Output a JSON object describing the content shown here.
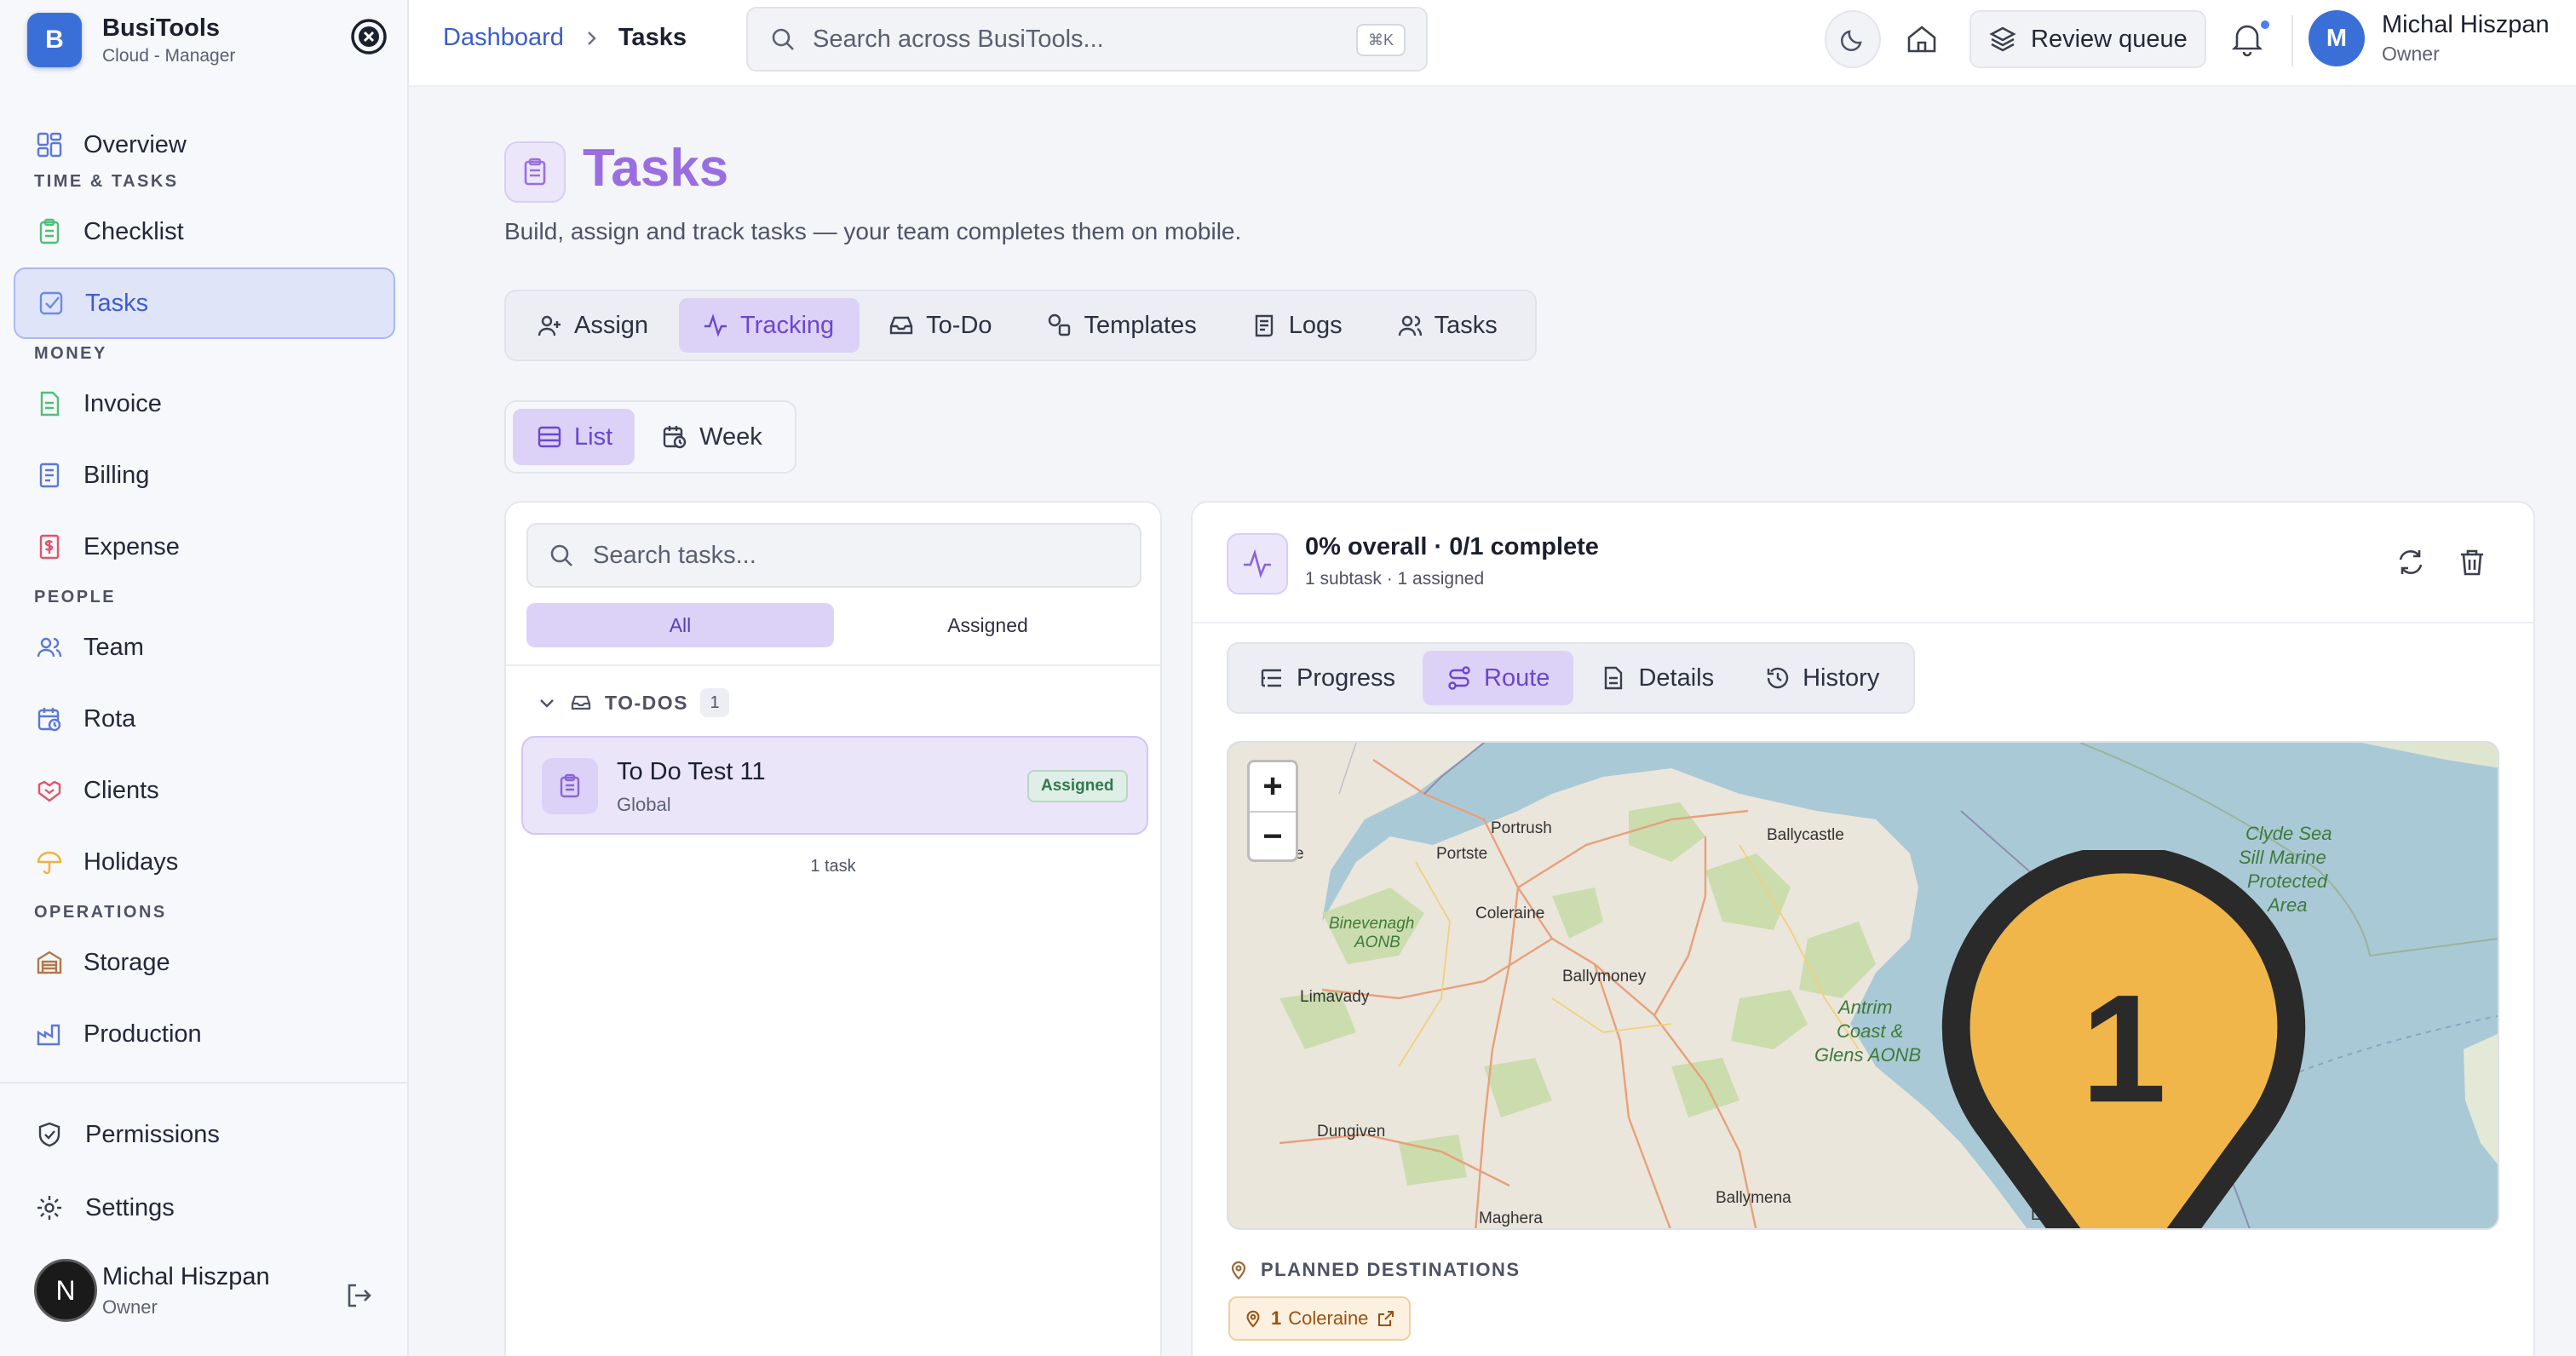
{
  "app": {
    "name": "BusiTools",
    "subtitle": "Cloud - Manager",
    "logo_letter": "B"
  },
  "sidebar": {
    "overview": "Overview",
    "sections": {
      "time": "TIME & TASKS",
      "money": "MONEY",
      "people": "PEOPLE",
      "operations": "OPERATIONS"
    },
    "items": {
      "checklist": "Checklist",
      "tasks": "Tasks",
      "invoice": "Invoice",
      "billing": "Billing",
      "expense": "Expense",
      "team": "Team",
      "rota": "Rota",
      "clients": "Clients",
      "holidays": "Holidays",
      "storage": "Storage",
      "production": "Production"
    },
    "permissions": "Permissions",
    "settings": "Settings",
    "user": {
      "initial": "N",
      "name": "Michal Hiszpan",
      "role": "Owner"
    }
  },
  "topbar": {
    "breadcrumb": {
      "root": "Dashboard",
      "current": "Tasks"
    },
    "search_placeholder": "Search across BusiTools...",
    "shortcut": "⌘K",
    "review_queue": "Review queue",
    "user": {
      "initial": "M",
      "name": "Michal Hiszpan",
      "role": "Owner"
    }
  },
  "page": {
    "title": "Tasks",
    "subtitle": "Build, assign and track tasks — your team completes them on mobile.",
    "tabs": [
      "Assign",
      "Tracking",
      "To-Do",
      "Templates",
      "Logs",
      "Tasks"
    ],
    "active_tab": "Tracking",
    "views": [
      "List",
      "Week"
    ],
    "active_view": "List"
  },
  "task_list": {
    "search_placeholder": "Search tasks...",
    "filters": [
      "All",
      "Assigned"
    ],
    "group": {
      "label": "TO-DOS",
      "count": "1"
    },
    "task": {
      "title": "To Do Test 11",
      "scope": "Global",
      "status": "Assigned"
    },
    "footer": "1 task"
  },
  "detail": {
    "title": "0% overall · 0/1 complete",
    "subtitle": "1 subtask · 1 assigned",
    "tabs": [
      "Progress",
      "Route",
      "Details",
      "History"
    ],
    "active_tab": "Route",
    "map": {
      "zoom_in": "+",
      "zoom_out": "−",
      "pin_number": "1",
      "places": {
        "portrush": "Portrush",
        "portstewart": "Portste",
        "coleraine": "Coleraine",
        "ballycastle": "Ballycastle",
        "ballymoney": "Ballymoney",
        "limavady": "Limavady",
        "dungiven": "Dungiven",
        "ballymena": "Ballymena",
        "larne": "Larne",
        "maghera": "Maghera",
        "edge": "e",
        "binevenagh": [
          "Binevenagh",
          "AONB"
        ],
        "antrim": [
          "Antrim",
          "Coast &",
          "Glens AONB"
        ],
        "clyde": [
          "Clyde Sea",
          "Sill Marine",
          "Protected",
          "Area"
        ]
      }
    },
    "destinations": {
      "label": "PLANNED DESTINATIONS",
      "number": "1",
      "place": "Coleraine"
    }
  },
  "colors": {
    "accent": "#9a6ee0",
    "active_bg": "#dcd2f7",
    "brand": "#3b6fd8",
    "badge_green": "#2e7a4d",
    "pin": "#f0b64a"
  }
}
